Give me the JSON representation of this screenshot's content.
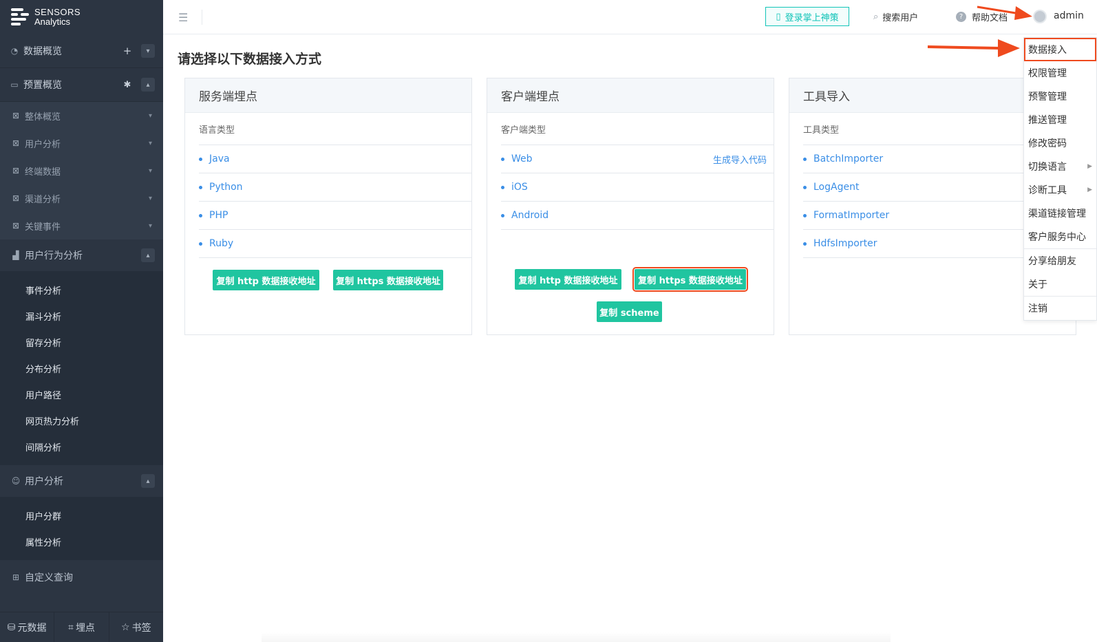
{
  "brand": {
    "line1": "SENSORS",
    "line2": "Analytics"
  },
  "sidebar": {
    "top": [
      {
        "label": "数据概览",
        "icon": "dashboard-icon"
      },
      {
        "label": "预置概览",
        "icon": "preset-icon"
      }
    ],
    "preset_children": [
      "整体概览",
      "用户分析",
      "终端数据",
      "渠道分析",
      "关键事件"
    ],
    "behavior": {
      "label": "用户行为分析",
      "items": [
        "事件分析",
        "漏斗分析",
        "留存分析",
        "分布分析",
        "用户路径",
        "网页热力分析",
        "间隔分析"
      ]
    },
    "user": {
      "label": "用户分析",
      "items": [
        "用户分群",
        "属性分析"
      ]
    },
    "custom_query": "自定义查询",
    "bottom": [
      "元数据",
      "埋点",
      "书签"
    ]
  },
  "header": {
    "mobile_login": "登录掌上神策",
    "search_user": "搜索用户",
    "help_docs": "帮助文档",
    "user": "admin"
  },
  "main": {
    "title": "请选择以下数据接入方式",
    "cards": [
      {
        "title": "服务端埋点",
        "type_label": "语言类型",
        "items": [
          "Java",
          "Python",
          "PHP",
          "Ruby"
        ],
        "buttons": [
          "复制 http 数据接收地址",
          "复制 https 数据接收地址"
        ]
      },
      {
        "title": "客户端埋点",
        "type_label": "客户端类型",
        "items": [
          "Web",
          "iOS",
          "Android"
        ],
        "gen_code": "生成导入代码",
        "buttons": [
          "复制 http 数据接收地址",
          "复制 https 数据接收地址",
          "复制 scheme"
        ]
      },
      {
        "title": "工具导入",
        "type_label": "工具类型",
        "items": [
          "BatchImporter",
          "LogAgent",
          "FormatImporter",
          "HdfsImporter"
        ]
      }
    ]
  },
  "dropdown": {
    "items": [
      "数据接入",
      "权限管理",
      "预警管理",
      "推送管理",
      "修改密码",
      "切换语言",
      "诊断工具",
      "渠道链接管理",
      "客户服务中心",
      "分享给朋友",
      "关于",
      "注销"
    ]
  },
  "colors": {
    "accent": "#20c5a0",
    "link": "#3a8ee6",
    "highlight": "#ef4a1e",
    "sidebar_bg": "#2c3542"
  }
}
